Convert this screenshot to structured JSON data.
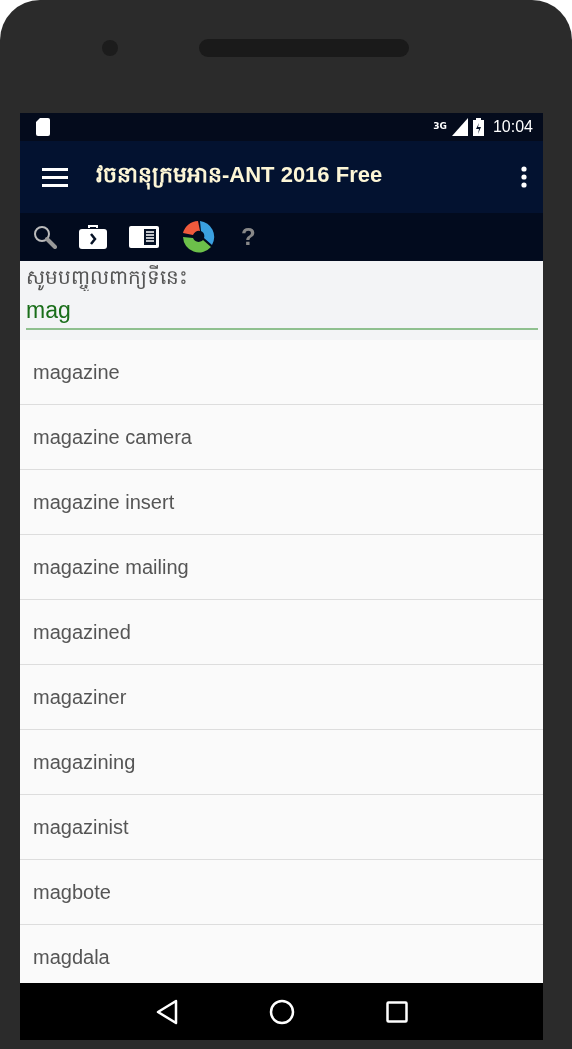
{
  "status_bar": {
    "network": "3G",
    "time": "10:04"
  },
  "app_bar": {
    "title": "វចនានុក្រមអាន-ANT 2016 Free"
  },
  "toolbar": {
    "help": "?"
  },
  "search": {
    "label": "សូមបញ្ចូលពាក្យទីនេះ",
    "value": "mag"
  },
  "results": [
    "magazine",
    "magazine camera",
    "magazine insert",
    "magazine mailing",
    "magazined",
    "magaziner",
    "magazining",
    "magazinist",
    "magbote",
    "magdala"
  ]
}
